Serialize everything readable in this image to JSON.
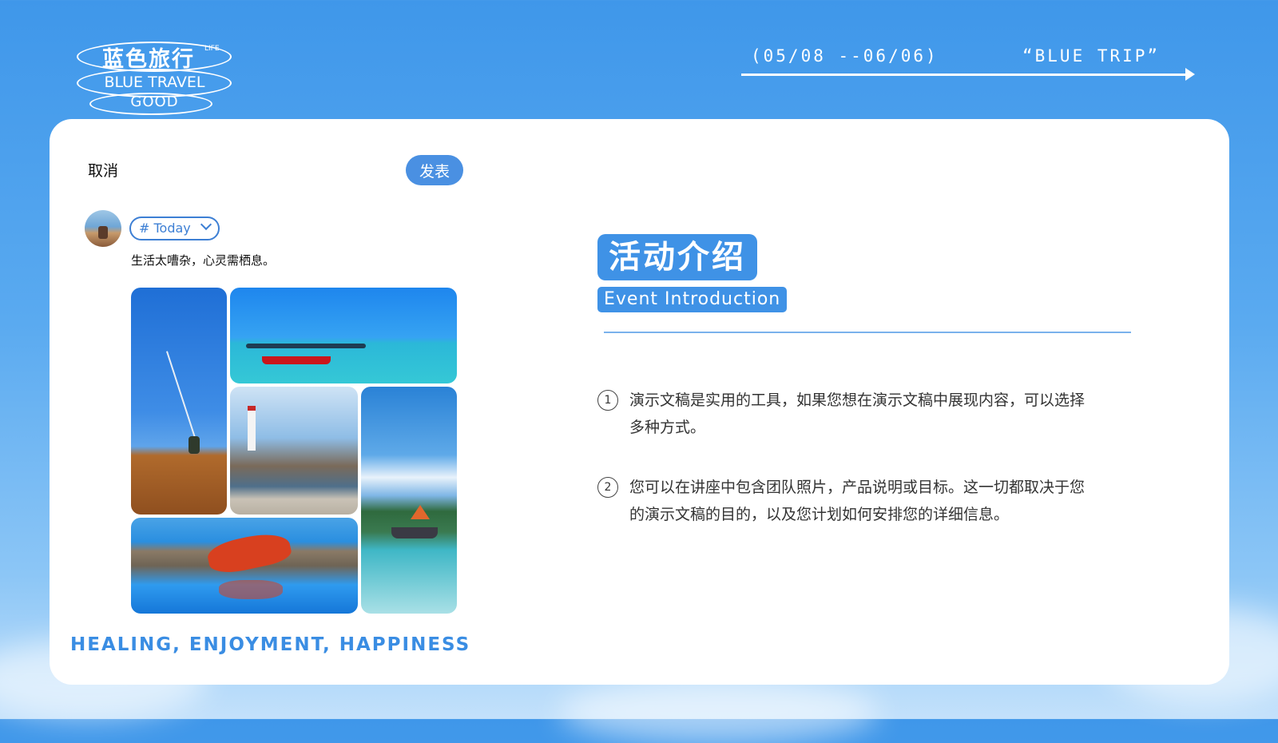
{
  "logo": {
    "title_cn": "蓝色旅行",
    "life": "LIFE",
    "title_en": "BLUE TRAVEL",
    "good": "GOOD"
  },
  "header": {
    "date_range": "(05/08 --06/06)",
    "trip_label": "“BLUE TRIP”"
  },
  "composer": {
    "cancel_label": "取消",
    "publish_label": "发表",
    "tag_label": "# Today",
    "post_text": "生活太嘈杂，心灵需栖息。"
  },
  "photos": [
    "fishing-cliff",
    "red-boat-sea",
    "lighthouse",
    "sailboat-bay",
    "woman-reflection"
  ],
  "footer_tagline": "HEALING, ENJOYMENT, HAPPINESS",
  "intro": {
    "title_cn": "活动介绍",
    "title_en": "Event Introduction",
    "items": [
      {
        "num": "1",
        "text": "演示文稿是实用的工具，如果您想在演示文稿中展现内容，可以选择多种方式。"
      },
      {
        "num": "2",
        "text": "您可以在讲座中包含团队照片，产品说明或目标。这一切都取决于您的演示文稿的目的，以及您计划如何安排您的详细信息。"
      }
    ]
  },
  "colors": {
    "accent": "#3f92e6",
    "sky_top": "#3f97ea",
    "card": "#ffffff"
  }
}
